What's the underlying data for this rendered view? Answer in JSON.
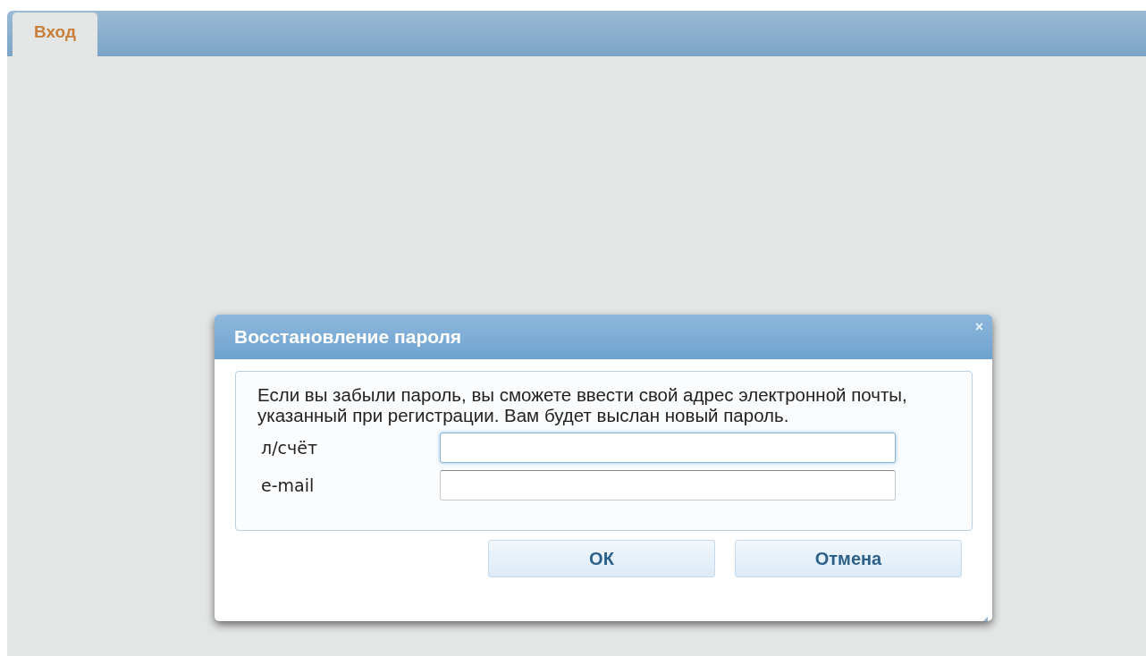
{
  "tabs": [
    {
      "label": "Вход",
      "selected": true
    }
  ],
  "dialog": {
    "title": "Восстановление пароля",
    "close": "×",
    "message": "Если вы забыли пароль, вы сможете ввести свой адрес электронной почты, указанный при регистрации. Вам будет выслан новый пароль.",
    "fields": [
      {
        "label": "л/счёт",
        "focused": true
      },
      {
        "label": "e-mail",
        "focused": false
      }
    ],
    "buttons": [
      "ОК",
      "Отмена"
    ]
  }
}
